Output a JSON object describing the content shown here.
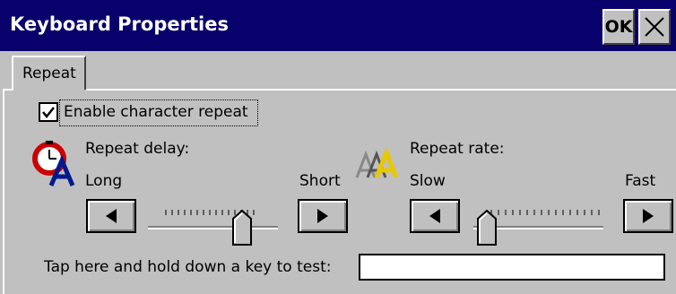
{
  "window": {
    "title": "Keyboard Properties",
    "ok_label": "OK"
  },
  "tabs": [
    {
      "label": "Repeat"
    }
  ],
  "repeat": {
    "enable_checkbox": {
      "label": "Enable character repeat",
      "checked": true
    },
    "delay": {
      "label": "Repeat delay:",
      "min_label": "Long",
      "max_label": "Short",
      "value_fraction": 0.75
    },
    "rate": {
      "label": "Repeat rate:",
      "min_label": "Slow",
      "max_label": "Fast",
      "value_fraction": 0.0
    },
    "test_label": "Tap here and hold down a key to test:",
    "test_value": ""
  },
  "colors": {
    "titlebar": "#08006b",
    "face": "#c0c0c0"
  }
}
